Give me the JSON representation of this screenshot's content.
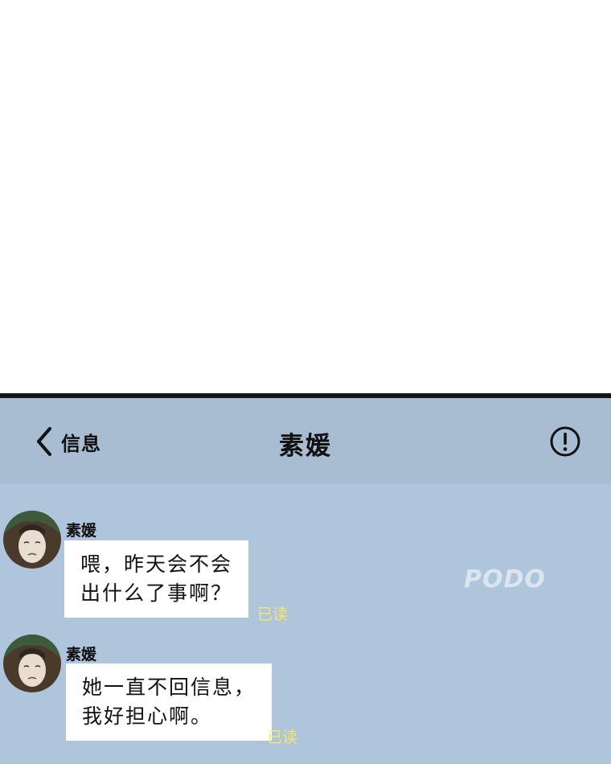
{
  "nav": {
    "back_label": "信息",
    "title": "素媛",
    "back_icon": "chevron-left-icon",
    "info_icon": "exclamation-circle-icon"
  },
  "watermark": "PODO",
  "messages": [
    {
      "sender": "素媛",
      "text": "喂，昨天会不会\n出什么了事啊？",
      "status": "已读"
    },
    {
      "sender": "素媛",
      "text": "她一直不回信息，\n我好担心啊。",
      "status": "已读"
    }
  ],
  "colors": {
    "screen_bg": "#afc5dc",
    "nav_bg": "#a8bdd2",
    "bubble_bg": "#ffffff",
    "read_status": "#f5e76a"
  }
}
